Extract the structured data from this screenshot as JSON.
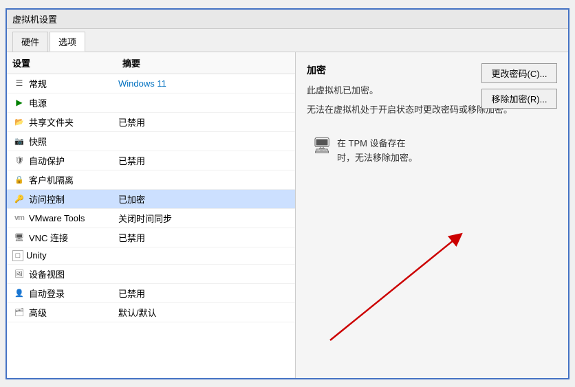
{
  "window": {
    "title": "虚拟机设置"
  },
  "tabs": [
    {
      "id": "hardware",
      "label": "硬件"
    },
    {
      "id": "options",
      "label": "选项",
      "active": true
    }
  ],
  "list": {
    "col1": "设置",
    "col2": "摘要",
    "items": [
      {
        "id": "general",
        "icon": "☰",
        "name": "常规",
        "value": "Windows 11",
        "valueClass": "colored",
        "selected": false
      },
      {
        "id": "power",
        "icon": "▶",
        "name": "电源",
        "value": "",
        "valueClass": "normal",
        "selected": false
      },
      {
        "id": "shared-folders",
        "icon": "📁",
        "name": "共享文件夹",
        "value": "已禁用",
        "valueClass": "normal",
        "selected": false
      },
      {
        "id": "snapshot",
        "icon": "📷",
        "name": "快照",
        "value": "",
        "valueClass": "normal",
        "selected": false
      },
      {
        "id": "autoprotect",
        "icon": "🛡",
        "name": "自动保护",
        "value": "已禁用",
        "valueClass": "normal",
        "selected": false
      },
      {
        "id": "guest-isolation",
        "icon": "🔒",
        "name": "客户机隔离",
        "value": "",
        "valueClass": "normal",
        "selected": false
      },
      {
        "id": "access-control",
        "icon": "🔑",
        "name": "访问控制",
        "value": "已加密",
        "valueClass": "normal",
        "selected": true
      },
      {
        "id": "vmware-tools",
        "icon": "⚙",
        "name": "VMware Tools",
        "value": "关闭时间同步",
        "valueClass": "normal",
        "selected": false
      },
      {
        "id": "vnc",
        "icon": "🖥",
        "name": "VNC 连接",
        "value": "已禁用",
        "valueClass": "normal",
        "selected": false
      },
      {
        "id": "unity",
        "icon": "□",
        "name": "Unity",
        "value": "",
        "valueClass": "normal",
        "selected": false
      },
      {
        "id": "device-view",
        "icon": "🖼",
        "name": "设备视图",
        "value": "",
        "valueClass": "normal",
        "selected": false
      },
      {
        "id": "autologon",
        "icon": "👤",
        "name": "自动登录",
        "value": "已禁用",
        "valueClass": "normal",
        "selected": false
      },
      {
        "id": "advanced",
        "icon": "🗂",
        "name": "高级",
        "value": "默认/默认",
        "valueClass": "normal",
        "selected": false
      }
    ]
  },
  "right": {
    "section_title": "加密",
    "desc1": "此虚拟机已加密。",
    "desc2": "无法在虚拟机处于开启状态时更改密码或移除加密。",
    "btn_change": "更改密码(C)...",
    "btn_remove": "移除加密(R)...",
    "tpm_text": "在 TPM 设备存在\n时，无法移除加密。"
  }
}
